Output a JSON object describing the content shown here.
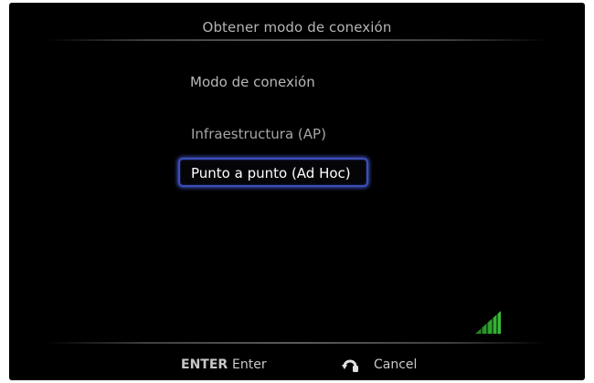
{
  "screen": {
    "title": "Obtener modo de conexión"
  },
  "menu": {
    "heading": "Modo de conexión",
    "options": [
      {
        "label": "Infraestructura (AP)",
        "selected": false
      },
      {
        "label": "Punto a punto (Ad Hoc)",
        "selected": true
      }
    ]
  },
  "status": {
    "signal_icon": "signal-strength-icon",
    "signal_color": "#2faa2f"
  },
  "footer": {
    "enter_key": "ENTER",
    "enter_action": "Enter",
    "back_icon": "return-arrow-icon",
    "cancel_action": "Cancel"
  },
  "colors": {
    "background": "#000000",
    "highlight": "#3b4fb8",
    "text": "#b4b4b4"
  }
}
